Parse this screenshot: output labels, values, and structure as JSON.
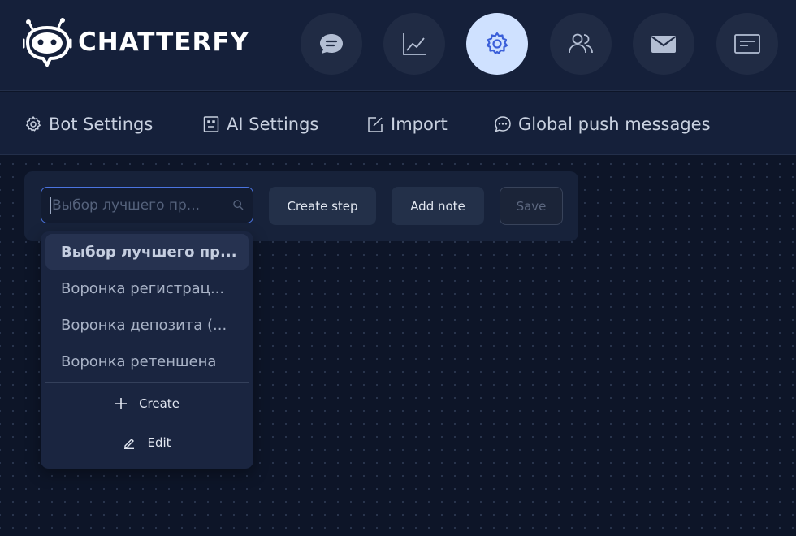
{
  "app": {
    "logo_text": "CHATTERFY"
  },
  "nav": {
    "buttons": [
      {
        "icon": "chat-bubble-icon",
        "active": false
      },
      {
        "icon": "line-chart-icon",
        "active": false
      },
      {
        "icon": "gear-icon",
        "active": true
      },
      {
        "icon": "users-icon",
        "active": false
      },
      {
        "icon": "envelope-icon",
        "active": false
      },
      {
        "icon": "message-card-icon",
        "active": false
      }
    ]
  },
  "subnav": {
    "tabs": [
      {
        "label": "Bot Settings",
        "icon": "gear-icon"
      },
      {
        "label": "AI Settings",
        "icon": "robot-face-icon"
      },
      {
        "label": "Import",
        "icon": "edit-square-icon"
      },
      {
        "label": "Global push messages",
        "icon": "chat-dots-icon"
      }
    ]
  },
  "toolbar": {
    "search_placeholder": "Выбор лучшего пр...",
    "create_step": "Create step",
    "add_note": "Add note",
    "save": "Save"
  },
  "dropdown": {
    "items": [
      {
        "label": "Выбор лучшего пр...",
        "selected": true
      },
      {
        "label": "Воронка регистрац...",
        "selected": false
      },
      {
        "label": "Воронка депозита (...",
        "selected": false
      },
      {
        "label": "Воронка ретеншена",
        "selected": false
      }
    ],
    "create": "Create",
    "edit": "Edit"
  },
  "colors": {
    "background": "#0d1528",
    "header": "#15203a",
    "active_nav": "#cfe1ff",
    "accent": "#4b74e0"
  }
}
